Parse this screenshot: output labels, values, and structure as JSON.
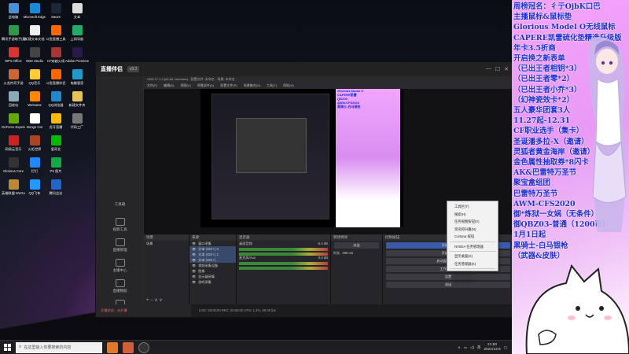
{
  "desktop": {
    "icons": [
      {
        "label": "此电脑",
        "icon": "computer-icon",
        "color": "#4a8fd8"
      },
      {
        "label": "腾讯手游助手(魔兽世界)",
        "icon": "game-icon",
        "color": "#2c9a4a"
      },
      {
        "label": "WPS Office",
        "icon": "wps-icon",
        "color": "#d33"
      },
      {
        "label": "火龙传奇手游",
        "icon": "game-icon",
        "color": "#c63"
      },
      {
        "label": "回收站",
        "icon": "recycle-bin-icon",
        "color": "#8ab"
      },
      {
        "label": "GeForce Experience",
        "icon": "nvidia-icon",
        "color": "#6a0"
      },
      {
        "label": "网易云音乐",
        "icon": "music-icon",
        "color": "#c22"
      },
      {
        "label": "Glorious Core",
        "icon": "glorious-icon",
        "color": "#333"
      },
      {
        "label": "英雄联盟 WeGame",
        "icon": "lol-icon",
        "color": "#b83"
      },
      {
        "label": "Microsoft Edge",
        "icon": "edge-icon",
        "color": "#1a8ad8"
      },
      {
        "label": "新建文本文档",
        "icon": "text-file-icon",
        "color": "#eee"
      },
      {
        "label": "OBS Studio",
        "icon": "obs-icon",
        "color": "#444"
      },
      {
        "label": "QQ音乐",
        "icon": "qqmusic-icon",
        "color": "#fc3"
      },
      {
        "label": "WeGame",
        "icon": "wegame-icon",
        "color": "#f80"
      },
      {
        "label": "Bongo Cat",
        "icon": "cat-icon",
        "color": "#fff"
      },
      {
        "label": "火炬世界",
        "icon": "torch-icon",
        "color": "#a42"
      },
      {
        "label": "钉钉",
        "icon": "dingtalk-icon",
        "color": "#28f"
      },
      {
        "label": "QQ飞车",
        "icon": "qqspeed-icon",
        "color": "#29f"
      },
      {
        "label": "Steam",
        "icon": "steam-icon",
        "color": "#1b2838"
      },
      {
        "label": "斗鱼直播工具",
        "icon": "douyu-icon",
        "color": "#f60"
      },
      {
        "label": "CF穿越火线",
        "icon": "cf-icon",
        "color": "#a33"
      },
      {
        "label": "斗鱼直播伴侣",
        "icon": "douyu-icon",
        "color": "#f60"
      },
      {
        "label": "QQ浏览器",
        "icon": "qqbrowser-icon",
        "color": "#28c"
      },
      {
        "label": "虎牙直播",
        "icon": "huya-icon",
        "color": "#fb0"
      },
      {
        "label": "爱奇艺",
        "icon": "iqiyi-icon",
        "color": "#0b0"
      },
      {
        "label": "PS 图片",
        "icon": "ps-icon",
        "color": "#1a4"
      },
      {
        "label": "腾讯会议",
        "icon": "meeting-icon",
        "color": "#26c"
      },
      {
        "label": "文本",
        "icon": "text-file-icon",
        "color": "#ddd"
      },
      {
        "label": "上网导航",
        "icon": "browser-icon",
        "color": "#2a6"
      },
      {
        "label": "Adobe Premiere",
        "icon": "premiere-icon",
        "color": "#2a1a4a"
      },
      {
        "label": "电脑管家",
        "icon": "pcmanager-icon",
        "color": "#29c"
      },
      {
        "label": "新建文件夹",
        "icon": "folder-icon",
        "color": "#e6c35a"
      },
      {
        "label": "代码工厂",
        "icon": "app-icon",
        "color": "#777"
      }
    ]
  },
  "live_app": {
    "title": "直播伴侣",
    "version_chip": "v3.2",
    "sidebar": [
      {
        "label": "工具箱"
      },
      {
        "label": "视频工具"
      },
      {
        "label": "直播管理"
      },
      {
        "label": "主播中心"
      },
      {
        "label": "直播数据"
      },
      {
        "label": "设置"
      }
    ],
    "footer_warning": "开播状态：未开播"
  },
  "obs": {
    "title_bar": "OBS 27.1.3 (64-bit, windows) - 配置文件: 未命名 - 场景: 未命名",
    "menu": [
      "文件(F)",
      "编辑(E)",
      "视图(V)",
      "停靠部件(D)",
      "配置文件(P)",
      "场景集合(S)",
      "工具(T)",
      "帮助(H)"
    ],
    "docks": {
      "scenes_header": "场景",
      "scenes": [
        "场景"
      ],
      "sources_header": "来源",
      "sources": [
        {
          "name": "窗口采集",
          "selected": false
        },
        {
          "name": "文本 (GDI+) 3",
          "selected": true
        },
        {
          "name": "文本 (GDI+) 2",
          "selected": true
        },
        {
          "name": "文本 (GDI+)",
          "selected": true
        },
        {
          "name": "视频采集设备",
          "selected": false
        },
        {
          "name": "图像",
          "selected": false
        },
        {
          "name": "显示器采集",
          "selected": false
        },
        {
          "name": "游戏采集",
          "selected": false
        }
      ],
      "mixer_header": "混音器",
      "mixer": [
        {
          "name": "桌面音频",
          "db": "-5.3 dB"
        },
        {
          "name": "麦克风/Aux",
          "db": "0.0 dB"
        }
      ],
      "transitions_header": "转场特效",
      "transition": "淡出",
      "duration_label": "时长",
      "duration": "300 ms",
      "controls_header": "控制按钮",
      "controls": [
        "开始推流",
        "开始录制",
        "启动虚拟摄像机",
        "工作室模式",
        "设置",
        "退出"
      ]
    },
    "status": "LIVE: 00:00:00   REC: 00:00:00   CPU: 1.4%, 60.00 fps"
  },
  "preview": {
    "mini_text": [
      "Glorious Model O",
      "CAPERE凯雷",
      "QBZ03",
      "AWM-CFS2020",
      "黑骑士-白马银枪"
    ]
  },
  "context_menu": {
    "items": [
      "工具栏(T)",
      "搜索(H)",
      "任务视图按钮(V)",
      "资讯和兴趣(N)",
      "Cortana 按钮",
      "NVIDIA 任务管理器",
      "显示桌面(S)",
      "任务管理器(K)",
      "锁定任务栏(L)",
      "任务栏设置(T)"
    ]
  },
  "overlay": {
    "lines": [
      "周榜冠名：彳亍OjbK口巴",
      "主播鼠标&鼠标垫",
      "Glorious Model O无线鼠标",
      "CAPERE凯雷硫化垫精选升级版",
      "年卡3.5折商",
      "开启换之新表单",
      "（已出王者相钥*3）",
      "（已出王者零*2）",
      "（已出王者小乔*3）",
      "（幻神瓷效卡*2）",
      "五人豪华团套3人",
      "11.27起-12.31",
      "CF职业选手（集卡）",
      "圣诞潘多拉-X（邀请）",
      "灵狐者黄金海岸（邀请）",
      "金色属性抽取券*8闪卡",
      "AK&巴雷特万圣节",
      "聚宝盒组团",
      "巴雷特万圣节",
      "AWM-CFS2020",
      "御*炼狱一女娲（无条件）",
      "御QBZ03-普通（1200币）",
      "1月1日起",
      "黑骑士-白马银枪",
      "（武器&皮肤）"
    ]
  },
  "taskbar": {
    "search_placeholder": "在这里输入你要搜索的内容",
    "time": "21:50",
    "date": "2021/12/4",
    "ime": "英"
  }
}
